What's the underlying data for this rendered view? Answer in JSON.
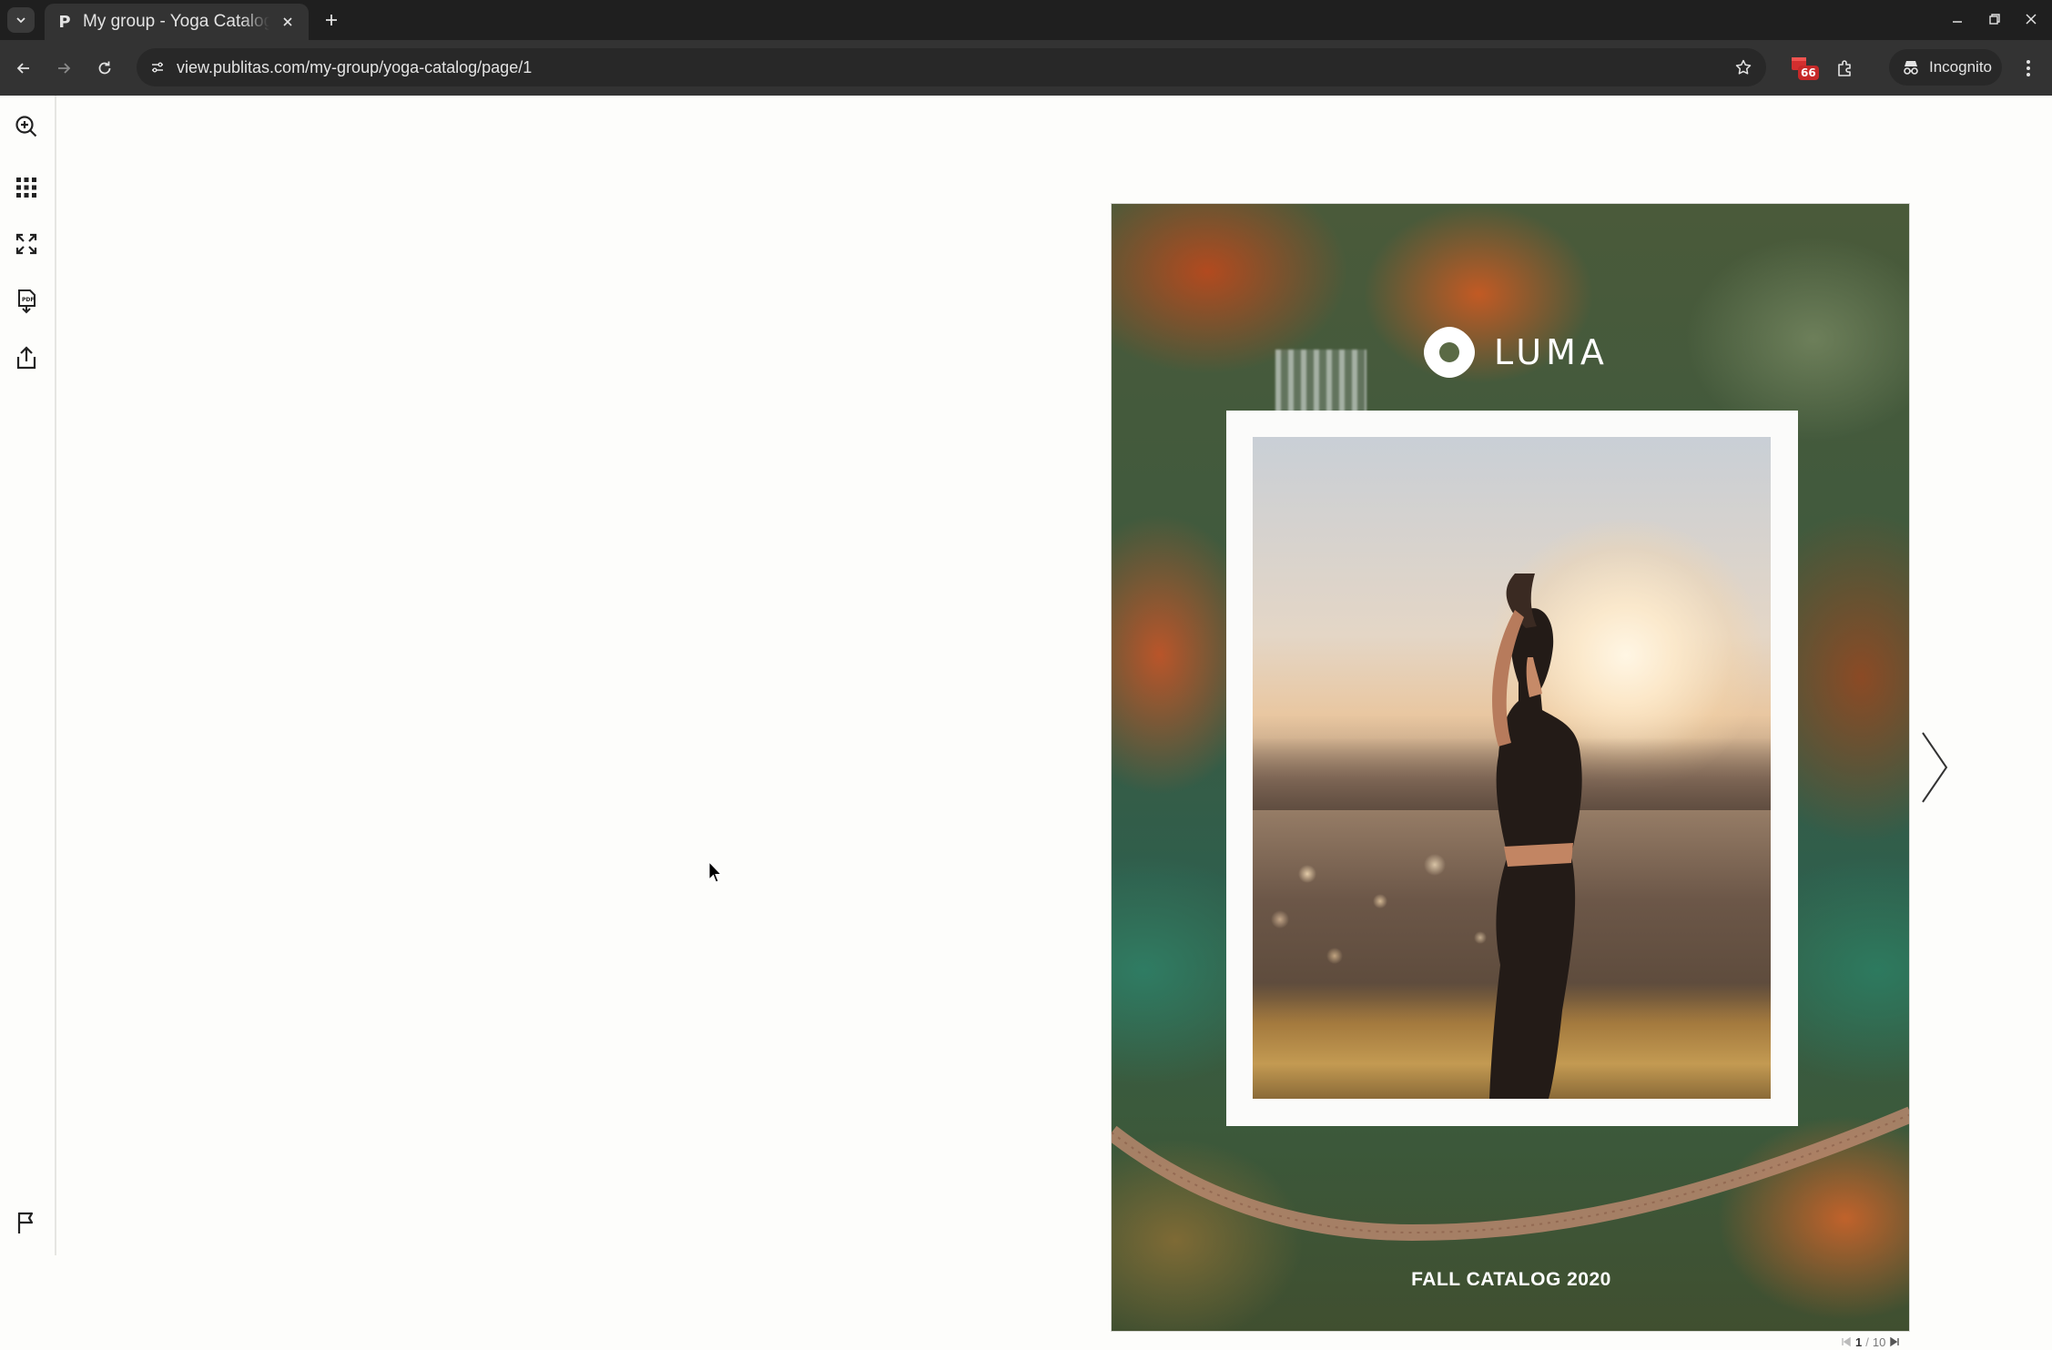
{
  "browser": {
    "tab": {
      "title": "My group - Yoga Catalog",
      "favicon": "publitas-p-icon"
    },
    "url": "view.publitas.com/my-group/yoga-catalog/page/1",
    "extension_badge": "66",
    "incognito_label": "Incognito"
  },
  "viewer": {
    "sidebar": [
      "zoom-in-icon",
      "grid-icon",
      "fullscreen-icon",
      "pdf-download-icon",
      "share-icon",
      "flag-icon"
    ],
    "cover": {
      "brand": "LUMA",
      "title": "FALL CATALOG 2020"
    },
    "pagination": {
      "current": "1",
      "separator": "/",
      "total": "10"
    },
    "colors": {
      "chrome_dark": "#1f1f1f",
      "toolbar": "#333333",
      "viewer_bg": "#fdfdfb"
    }
  }
}
